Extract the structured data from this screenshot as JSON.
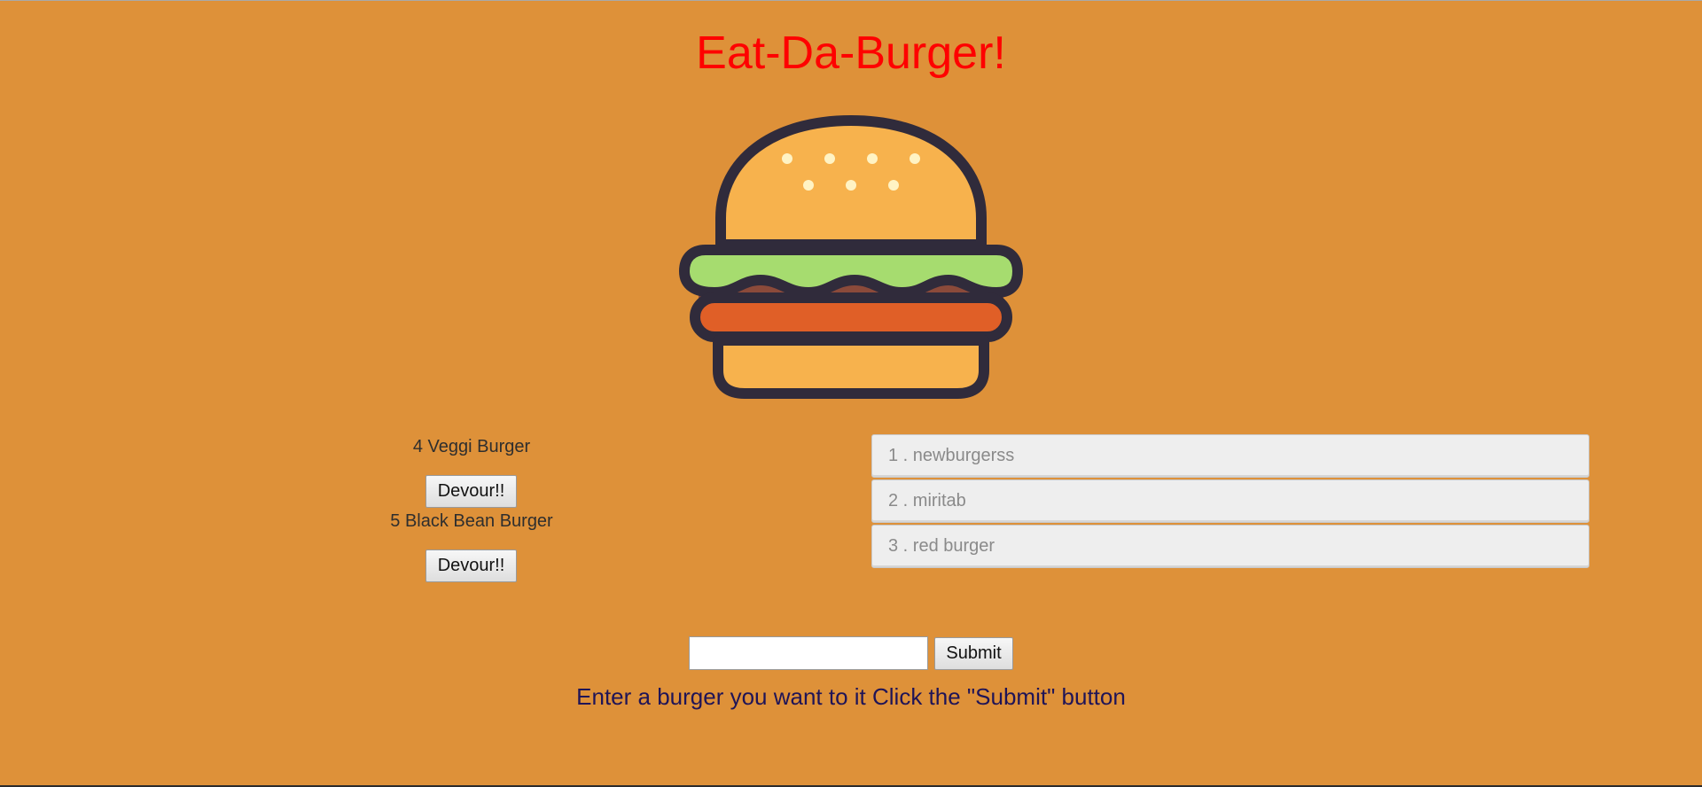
{
  "header": {
    "title": "Eat-Da-Burger!"
  },
  "logo": {
    "icon": "burger-icon",
    "colors": {
      "outline": "#302b3b",
      "bun": "#f7b24d",
      "seeds": "#fff3c4",
      "lettuce": "#a6dc6f",
      "patty": "#e05f27"
    }
  },
  "uneaten_burgers": [
    {
      "label": "4 Veggi Burger",
      "button_label": "Devour!!"
    },
    {
      "label": "5 Black Bean Burger",
      "button_label": "Devour!!"
    }
  ],
  "devoured_burgers": [
    {
      "label": "1 . newburgerss"
    },
    {
      "label": "2 . miritab"
    },
    {
      "label": "3 . red burger"
    }
  ],
  "form": {
    "input_value": "",
    "submit_label": "Submit",
    "instructions": "Enter a burger you want to it Click the \"Submit\" button"
  },
  "colors": {
    "background": "#de9139",
    "title": "#ff0000",
    "instructions": "#1f1457"
  }
}
